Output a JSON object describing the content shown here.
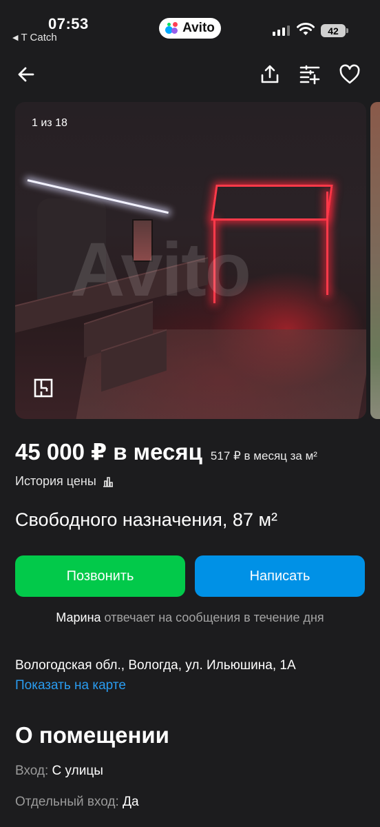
{
  "status_bar": {
    "time": "07:53",
    "back_app": "T Catch",
    "app_badge": "Avito",
    "battery": "42"
  },
  "gallery": {
    "counter": "1 из 18",
    "watermark": "Avito"
  },
  "listing": {
    "price": "45 000 ₽ в месяц",
    "price_per_m2": "517 ₽ в месяц за м²",
    "price_history": "История цены",
    "title": "Свободного назначения, 87 м²"
  },
  "actions": {
    "call_label": "Позвонить",
    "write_label": "Написать"
  },
  "seller": {
    "name": "Марина",
    "response_text": "отвечает на сообщения в течение дня"
  },
  "location": {
    "address": "Вологодская обл., Вологда, ул. Ильюшина, 1А",
    "map_link": "Показать на карте"
  },
  "about": {
    "heading": "О помещении",
    "properties": [
      {
        "key": "Вход:",
        "value": "С улицы"
      },
      {
        "key": "Отдельный вход:",
        "value": "Да"
      }
    ]
  },
  "colors": {
    "background": "#1c1c1e",
    "call_button": "#02c94a",
    "write_button": "#0091e6",
    "link": "#2a9cf0"
  },
  "icons": [
    "back-arrow-icon",
    "share-icon",
    "compare-icon",
    "heart-icon",
    "floor-plan-icon",
    "bar-chart-icon",
    "signal-icon",
    "wifi-icon"
  ]
}
